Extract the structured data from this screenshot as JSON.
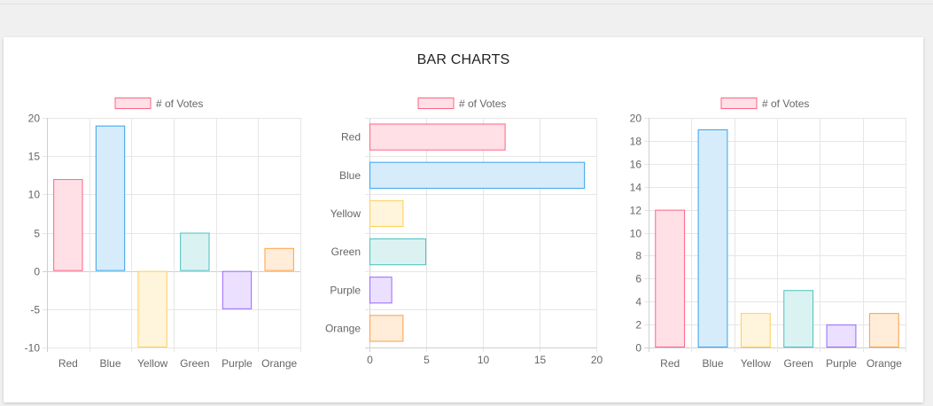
{
  "page": {
    "title": "BAR CHARTS"
  },
  "chart_data": [
    {
      "type": "bar",
      "orientation": "vertical",
      "legend": "# of Votes",
      "legend_position": "top",
      "categories": [
        "Red",
        "Blue",
        "Yellow",
        "Green",
        "Purple",
        "Orange"
      ],
      "values": [
        12,
        19,
        -10,
        5,
        -5,
        3
      ],
      "ylim": [
        -10,
        20
      ],
      "yticks": [
        20,
        15,
        10,
        5,
        0,
        -5,
        -10
      ],
      "grid": true,
      "colors": {
        "fills": [
          "#ffe0e6",
          "#d7ecfb",
          "#fff5dd",
          "#dbf2f2",
          "#ebe0ff",
          "#ffecd9"
        ],
        "borders": [
          "#ff6384",
          "#36a2eb",
          "#ffce56",
          "#4bc0c0",
          "#9966ff",
          "#ff9f40"
        ]
      }
    },
    {
      "type": "bar",
      "orientation": "horizontal",
      "legend": "# of Votes",
      "legend_position": "top",
      "categories": [
        "Red",
        "Blue",
        "Yellow",
        "Green",
        "Purple",
        "Orange"
      ],
      "values": [
        12,
        19,
        3,
        5,
        2,
        3
      ],
      "xlim": [
        0,
        20
      ],
      "xticks": [
        0,
        5,
        10,
        15,
        20
      ],
      "grid": true,
      "colors": {
        "fills": [
          "#ffe0e6",
          "#d7ecfb",
          "#fff5dd",
          "#dbf2f2",
          "#ebe0ff",
          "#ffecd9"
        ],
        "borders": [
          "#ff6384",
          "#36a2eb",
          "#ffce56",
          "#4bc0c0",
          "#9966ff",
          "#ff9f40"
        ]
      }
    },
    {
      "type": "bar",
      "orientation": "vertical",
      "legend": "# of Votes",
      "legend_position": "top",
      "categories": [
        "Red",
        "Blue",
        "Yellow",
        "Green",
        "Purple",
        "Orange"
      ],
      "values": [
        12,
        19,
        3,
        5,
        2,
        3
      ],
      "ylim": [
        0,
        20
      ],
      "yticks": [
        20,
        18,
        16,
        14,
        12,
        10,
        8,
        6,
        4,
        2,
        0
      ],
      "grid": true,
      "colors": {
        "fills": [
          "#ffe0e6",
          "#d7ecfb",
          "#fff5dd",
          "#dbf2f2",
          "#ebe0ff",
          "#ffecd9"
        ],
        "borders": [
          "#ff6384",
          "#36a2eb",
          "#ffce56",
          "#4bc0c0",
          "#9966ff",
          "#ff9f40"
        ]
      }
    }
  ]
}
